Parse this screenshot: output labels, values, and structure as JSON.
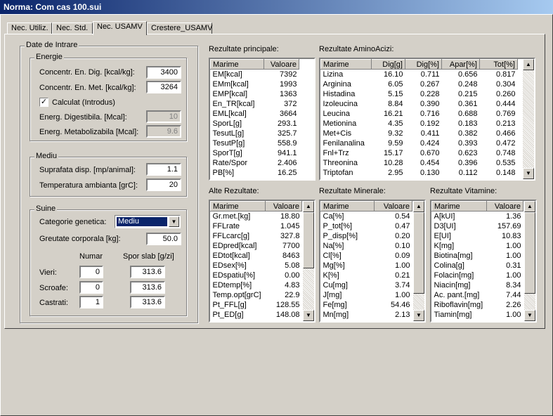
{
  "window": {
    "title": "Norma: Com cas 100.sui"
  },
  "tabs": [
    "Nec. Utiliz.",
    "Nec. Std.",
    "Nec. USAMV",
    "Crestere_USAMV"
  ],
  "date_intrare": {
    "title": "Date de Intrare",
    "energie": {
      "title": "Energie",
      "en_dig_label": "Concentr. En. Dig. [kcal/kg]:",
      "en_dig_value": "3400",
      "en_met_label": "Concentr. En. Met. [kcal/kg]:",
      "en_met_value": "3264",
      "calculat_label": "Calculat (Introdus)",
      "calculat_mark": "✓",
      "energ_dig_label": "Energ. Digestibila. [Mcal]:",
      "energ_dig_value": "10",
      "energ_met_label": "Energ. Metabolizabila [Mcal]:",
      "energ_met_value": "9.6"
    },
    "mediu": {
      "title": "Mediu",
      "suprafata_label": "Suprafata disp. [mp/animal]:",
      "suprafata_value": "1.1",
      "temperatura_label": "Temperatura ambianta [grC]:",
      "temperatura_value": "20"
    },
    "suine": {
      "title": "Suine",
      "categorie_label": "Categorie genetica:",
      "categorie_value": "Mediu",
      "greutate_label": "Greutate corporala [kg]:",
      "greutate_value": "50.0",
      "col_numar": "Numar",
      "col_spor": "Spor slab [g/zi]",
      "rows": [
        {
          "label": "Vieri:",
          "numar": "0",
          "spor": "313.6"
        },
        {
          "label": "Scroafe:",
          "numar": "0",
          "spor": "313.6"
        },
        {
          "label": "Castrati:",
          "numar": "1",
          "spor": "313.6"
        }
      ]
    }
  },
  "rezultate_principale": {
    "title": "Rezultate principale:",
    "headers": [
      "Marime",
      "Valoare"
    ],
    "rows": [
      [
        "EM[kcal]",
        "7392"
      ],
      [
        "EMm[kcal]",
        "1993"
      ],
      [
        "EMP[kcal]",
        "1363"
      ],
      [
        "En_TR[kcal]",
        "372"
      ],
      [
        "EML[kcal]",
        "3664"
      ],
      [
        "SporL[g]",
        "293.1"
      ],
      [
        "TesutL[g]",
        "325.7"
      ],
      [
        "TesutP[g]",
        "558.9"
      ],
      [
        "SporT[g]",
        "941.1"
      ],
      [
        "Rate/Spor",
        "2.406"
      ],
      [
        "PB[%]",
        "16.25"
      ]
    ]
  },
  "rezultate_aminoacizi": {
    "title": "Rezultate AminoAcizi:",
    "headers": [
      "Marime",
      "Dig[g]",
      "Dig[%]",
      "Apar[%]",
      "Tot[%]"
    ],
    "rows": [
      [
        "Lizina",
        "16.10",
        "0.711",
        "0.656",
        "0.817"
      ],
      [
        "Arginina",
        "6.05",
        "0.267",
        "0.248",
        "0.304"
      ],
      [
        "Histadina",
        "5.15",
        "0.228",
        "0.215",
        "0.260"
      ],
      [
        "Izoleucina",
        "8.84",
        "0.390",
        "0.361",
        "0.444"
      ],
      [
        "Leucina",
        "16.21",
        "0.716",
        "0.688",
        "0.769"
      ],
      [
        "Metionina",
        "4.35",
        "0.192",
        "0.183",
        "0.213"
      ],
      [
        "Met+Cis",
        "9.32",
        "0.411",
        "0.382",
        "0.466"
      ],
      [
        "Fenilanalina",
        "9.59",
        "0.424",
        "0.393",
        "0.472"
      ],
      [
        "Fnl+Trz",
        "15.17",
        "0.670",
        "0.623",
        "0.748"
      ],
      [
        "Threonina",
        "10.28",
        "0.454",
        "0.396",
        "0.535"
      ],
      [
        "Triptofan",
        "2.95",
        "0.130",
        "0.112",
        "0.148"
      ]
    ]
  },
  "alte_rezultate": {
    "title": "Alte Rezultate:",
    "headers": [
      "Marime",
      "Valoare"
    ],
    "rows": [
      [
        "Gr.met.[kg]",
        "18.80"
      ],
      [
        "FFLrate",
        "1.045"
      ],
      [
        "FFLcarc[g]",
        "327.8"
      ],
      [
        "EDpred[kcal]",
        "7700"
      ],
      [
        "EDtot[kcal]",
        "8463"
      ],
      [
        "EDsex[%]",
        "5.08"
      ],
      [
        "EDspatiu[%]",
        "0.00"
      ],
      [
        "EDtemp[%]",
        "4.83"
      ],
      [
        "Temp.opt[grC]",
        "22.9"
      ],
      [
        "Pt_FFL[g]",
        "128.55"
      ],
      [
        "Pt_ED[g]",
        "148.08"
      ]
    ]
  },
  "rezultate_minerale": {
    "title": "Rezultate Minerale:",
    "headers": [
      "Marime",
      "Valoare"
    ],
    "rows": [
      [
        "Ca[%]",
        "0.54"
      ],
      [
        "P_tot[%]",
        "0.47"
      ],
      [
        "P_disp[%]",
        "0.20"
      ],
      [
        "Na[%]",
        "0.10"
      ],
      [
        "Cl[%]",
        "0.09"
      ],
      [
        "Mg[%]",
        "1.00"
      ],
      [
        "K[%]",
        "0.21"
      ],
      [
        "Cu[mg]",
        "3.74"
      ],
      [
        "J[mg]",
        "1.00"
      ],
      [
        "Fe[mg]",
        "54.46"
      ],
      [
        "Mn[mg]",
        "2.13"
      ]
    ]
  },
  "rezultate_vitamine": {
    "title": "Rezultate Vitamine:",
    "headers": [
      "Marime",
      "Valoare"
    ],
    "rows": [
      [
        "A[kUI]",
        "1.36"
      ],
      [
        "D3[UI]",
        "157.69"
      ],
      [
        "E[UI]",
        "10.83"
      ],
      [
        "K[mg]",
        "1.00"
      ],
      [
        "Biotina[mg]",
        "1.00"
      ],
      [
        "Colina[g]",
        "0.31"
      ],
      [
        "Folacin[mg]",
        "1.00"
      ],
      [
        "Niacin[mg]",
        "8.34"
      ],
      [
        "Ac. pant.[mg]",
        "7.44"
      ],
      [
        "Riboflavin[mg]",
        "2.26"
      ],
      [
        "Tiamin[mg]",
        "1.00"
      ]
    ]
  },
  "icons": {
    "arrow_up": "▲",
    "arrow_down": "▼"
  },
  "colors": {
    "titlebar": "#0a246a",
    "face": "#d4d0c8",
    "selection": "#0a246a"
  }
}
